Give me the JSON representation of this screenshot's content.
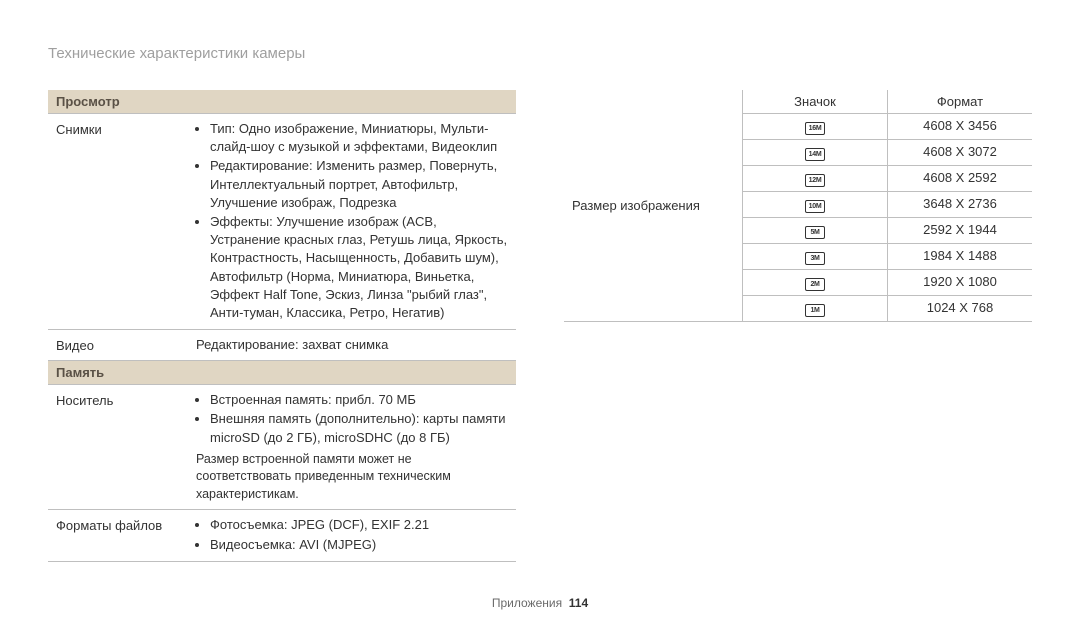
{
  "page_title": "Технические характеристики камеры",
  "sections": {
    "viewing": {
      "header": "Просмотр",
      "rows": {
        "photos": {
          "label": "Снимки",
          "items": [
            "Тип: Одно изображение, Миниатюры, Мульти-слайд-шоу с музыкой и эффектами, Видеоклип",
            "Редактирование: Изменить размер, Повернуть, Интеллектуальный портрет, Автофильтр, Улучшение изображ, Подрезка",
            "Эффекты: Улучшение изображ (ACB, Устранение красных глаз, Ретушь лица, Яркость, Контрастность, Насыщенность, Добавить шум), Автофильтр (Норма, Миниатюра, Виньетка, Эффект Half Tone, Эскиз, Линза \"рыбий глаз\", Анти-туман, Классика, Ретро, Негатив)"
          ]
        },
        "video": {
          "label": "Видео",
          "text": "Редактирование: захват снимка"
        }
      }
    },
    "memory": {
      "header": "Память",
      "rows": {
        "media": {
          "label": "Носитель",
          "items": [
            "Встроенная память: прибл. 70 МБ",
            "Внешняя память (дополнительно): карты памяти microSD (до 2 ГБ), microSDHC (до 8 ГБ)"
          ],
          "note": "Размер встроенной памяти может не соответствовать приведенным техническим характеристикам."
        },
        "formats": {
          "label": "Форматы файлов",
          "items": [
            "Фотосъемка: JPEG (DCF), EXIF 2.21",
            "Видеосъемка: AVI (MJPEG)"
          ]
        }
      }
    }
  },
  "image_size_table": {
    "row_label": "Размер изображения",
    "head": {
      "icon": "Значок",
      "format": "Формат"
    },
    "rows": [
      {
        "icon": "16M",
        "format": "4608 X 3456"
      },
      {
        "icon": "14M",
        "format": "4608 X 3072"
      },
      {
        "icon": "12M",
        "format": "4608 X 2592"
      },
      {
        "icon": "10M",
        "format": "3648 X 2736"
      },
      {
        "icon": "5M",
        "format": "2592 X 1944"
      },
      {
        "icon": "3M",
        "format": "1984 X 1488"
      },
      {
        "icon": "2M",
        "format": "1920 X 1080"
      },
      {
        "icon": "1M",
        "format": "1024 X 768"
      }
    ]
  },
  "footer": {
    "section": "Приложения",
    "page": "114"
  }
}
